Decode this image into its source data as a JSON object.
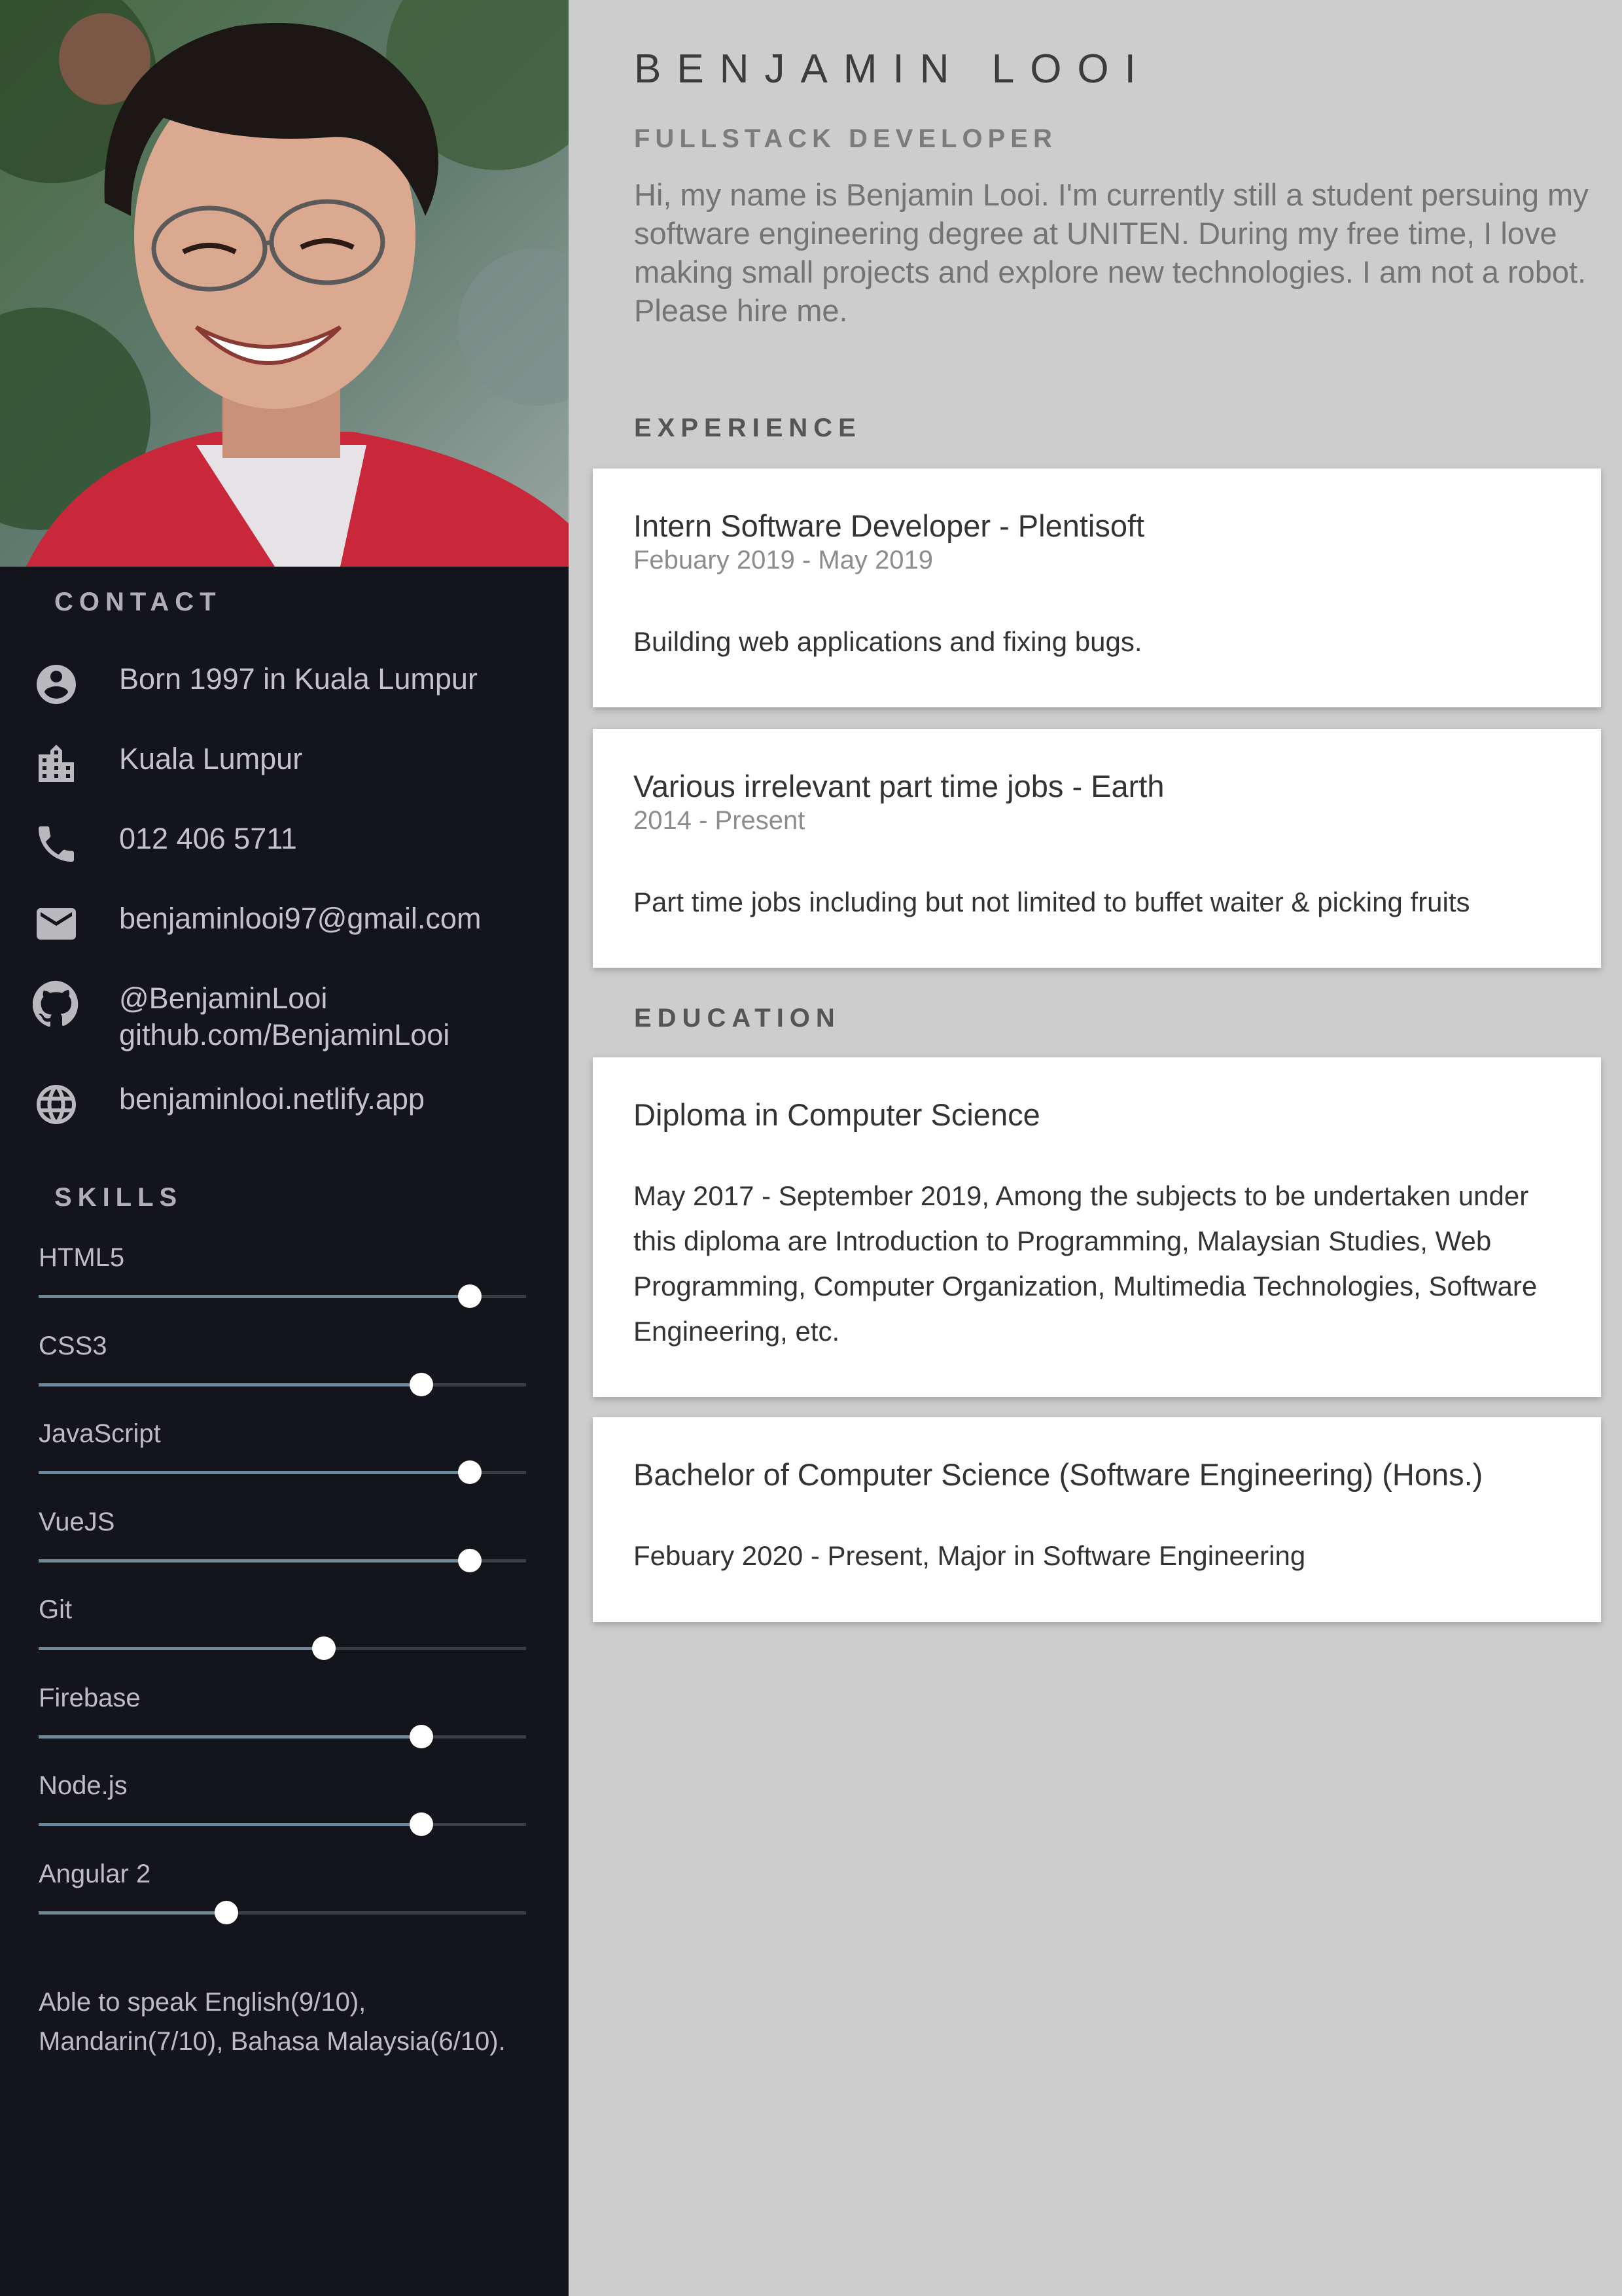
{
  "profile": {
    "name": "BENJAMIN LOOI",
    "role": "FULLSTACK DEVELOPER",
    "summary": "Hi, my name is Benjamin Looi. I'm currently still a student persuing my software engineering degree at UNITEN. During my free time, I love making small projects and explore new technologies. I am not a robot. Please hire me."
  },
  "contact": {
    "title": "CONTACT",
    "items": [
      {
        "icon": "account-circle-icon",
        "text": "Born 1997 in Kuala Lumpur"
      },
      {
        "icon": "city-icon",
        "text": "Kuala Lumpur"
      },
      {
        "icon": "phone-icon",
        "text": " 012 406 5711"
      },
      {
        "icon": "email-icon",
        "text": " benjaminlooi97@gmail.com"
      },
      {
        "icon": "github-icon",
        "text": "@BenjaminLooi",
        "text2": "github.com/BenjaminLooi"
      },
      {
        "icon": "globe-icon",
        "text": "benjaminlooi.netlify.app"
      }
    ]
  },
  "skills": {
    "title": "SKILLS",
    "items": [
      {
        "label": "HTML5",
        "level": 0.885
      },
      {
        "label": "CSS3",
        "level": 0.785
      },
      {
        "label": "JavaScript",
        "level": 0.885
      },
      {
        "label": "VueJS",
        "level": 0.885
      },
      {
        "label": "Git",
        "level": 0.585
      },
      {
        "label": "Firebase",
        "level": 0.785
      },
      {
        "label": "Node.js",
        "level": 0.785
      },
      {
        "label": "Angular 2",
        "level": 0.385
      }
    ],
    "languages": "Able to speak English(9/10), Mandarin(7/10), Bahasa Malaysia(6/10)."
  },
  "experience": {
    "title": "EXPERIENCE",
    "items": [
      {
        "title": "Intern Software Developer - Plentisoft",
        "date": "Febuary 2019 - May 2019",
        "desc": " Building web applications and fixing bugs."
      },
      {
        "title": "Various irrelevant part time jobs - Earth",
        "date": "2014 - Present",
        "desc": " Part time jobs including but not limited to buffet waiter & picking fruits"
      }
    ]
  },
  "education": {
    "title": "EDUCATION",
    "items": [
      {
        "title": "Diploma in Computer Science",
        "desc": " May 2017 - September 2019, Among the subjects to be undertaken under this diploma are Introduction to Programming, Malaysian Studies, Web Programming, Computer Organization, Multimedia Technologies, Software Engineering, etc."
      },
      {
        "title": "Bachelor of Computer Science (Software Engineering) (Hons.)",
        "desc": " Febuary 2020 - Present, Major in Software Engineering"
      }
    ]
  }
}
